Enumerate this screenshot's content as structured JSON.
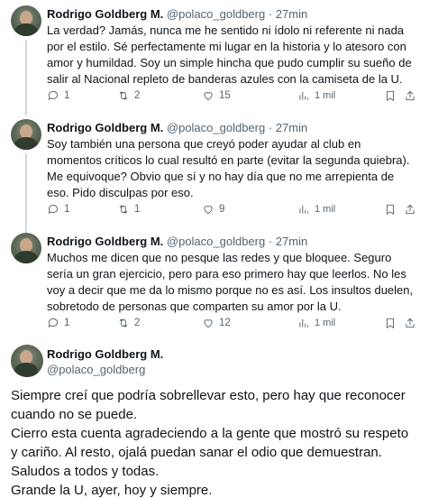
{
  "tweets": [
    {
      "author_name": "Rodrigo Goldberg M.",
      "author_handle": "@polaco_goldberg",
      "separator": "·",
      "time": "27min",
      "text": "La verdad? Jamás, nunca me he sentido ni ídolo ni referente ni nada por el estilo. Sé perfectamente mi lugar en la historia y lo atesoro con amor y humildad. Soy un simple hincha que pudo cumplir su sueño de salir al Nacional repleto de banderas azules con la camiseta de la U.",
      "replies": "1",
      "retweets": "2",
      "likes": "15",
      "views": "1 mil"
    },
    {
      "author_name": "Rodrigo Goldberg M.",
      "author_handle": "@polaco_goldberg",
      "separator": "·",
      "time": "27min",
      "text": "Soy también una persona que creyó poder ayudar al club en momentos críticos lo cual resultó en parte (evitar la segunda quiebra). Me equivoque? Obvio que sí y no hay día que no me arrepienta de eso. Pido disculpas por eso.",
      "replies": "1",
      "retweets": "1",
      "likes": "9",
      "views": "1 mil"
    },
    {
      "author_name": "Rodrigo Goldberg M.",
      "author_handle": "@polaco_goldberg",
      "separator": "·",
      "time": "27min",
      "text": "Muchos me dicen que no pesque las redes y que bloquee. Seguro sería un gran ejercicio, pero para eso primero hay que leerlos. No les voy a decir que me da lo mismo porque no es así. Los insultos duelen, sobretodo de personas que comparten su amor por la U.",
      "replies": "1",
      "retweets": "2",
      "likes": "12",
      "views": "1 mil"
    }
  ],
  "main_tweet": {
    "author_name": "Rodrigo Goldberg M.",
    "author_handle": "@polaco_goldberg",
    "lines": [
      "Siempre creí que podría sobrellevar esto, pero hay que reconocer cuando no se puede.",
      "Cierro esta cuenta agradeciendo a la gente que mostró su respeto y cariño. Al resto, ojalá puedan sanar el odio que demuestran.",
      "Saludos a todos y todas.",
      "Grande la U, ayer, hoy y siempre."
    ]
  },
  "icons": [
    "reply-icon",
    "retweet-icon",
    "like-icon",
    "views-icon",
    "bookmark-icon",
    "share-icon"
  ],
  "colors": {
    "text": "#0f1419",
    "secondary": "#536471",
    "thread_line": "#cfd9de",
    "background": "#ffffff"
  }
}
